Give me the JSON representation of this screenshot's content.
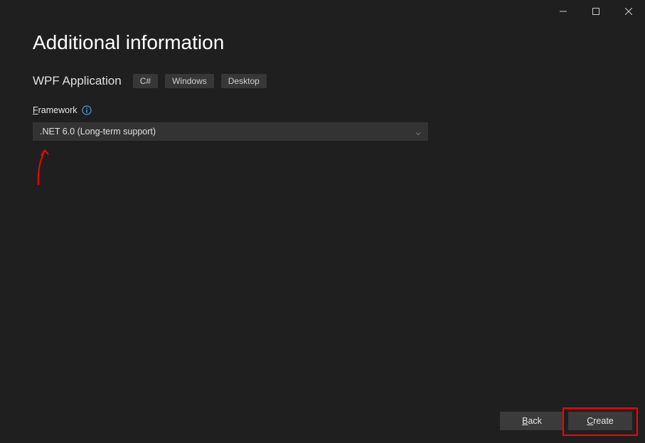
{
  "window": {
    "heading": "Additional information",
    "subhead": "WPF Application",
    "tags": [
      "C#",
      "Windows",
      "Desktop"
    ]
  },
  "framework": {
    "label_prefix": "F",
    "label_rest": "ramework",
    "selected": ".NET 6.0 (Long-term support)"
  },
  "buttons": {
    "back_prefix": "B",
    "back_rest": "ack",
    "create_prefix": "C",
    "create_rest": "reate"
  },
  "titlebar": {
    "minimize": "minimize",
    "maximize": "maximize",
    "close": "close"
  }
}
